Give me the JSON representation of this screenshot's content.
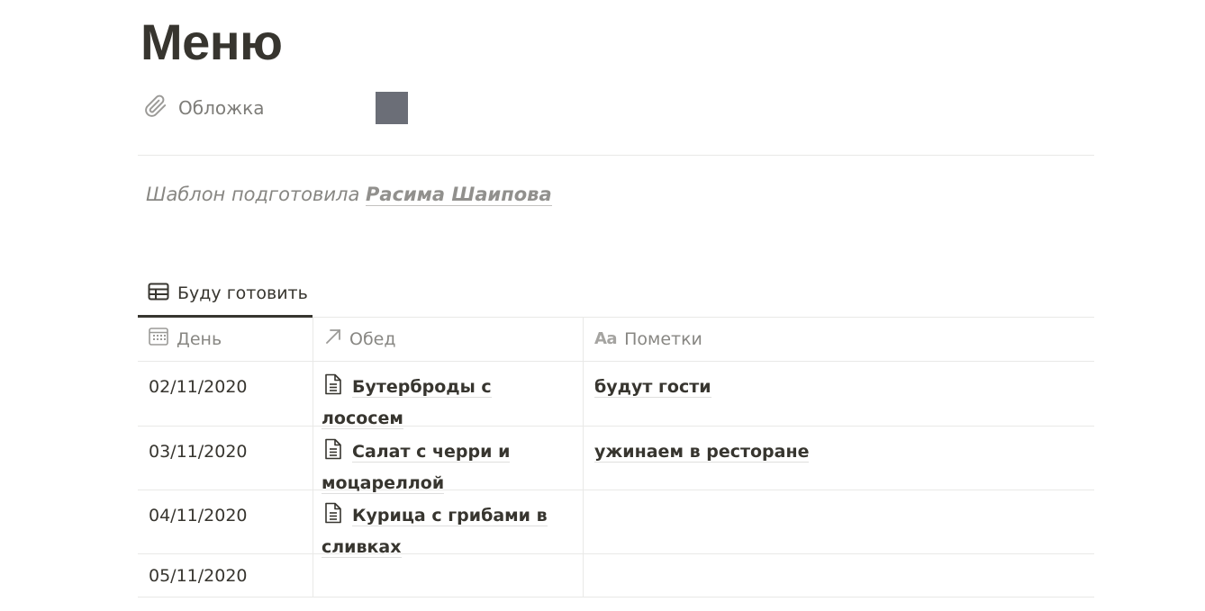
{
  "page": {
    "title": "Меню"
  },
  "properties": {
    "cover_label": "Обложка",
    "cover_color": "#6b6e77"
  },
  "credit": {
    "prefix": "Шаблон подготовила",
    "author": "Расима Шаипова"
  },
  "view": {
    "tab_label": "Буду готовить"
  },
  "table": {
    "columns": [
      {
        "label": "День",
        "icon": "calendar-icon"
      },
      {
        "label": "Обед",
        "icon": "relation-arrow-icon"
      },
      {
        "label": "Пометки",
        "icon": "text-aa-icon"
      }
    ],
    "rows": [
      {
        "date": "02/11/2020",
        "dish": "Бутерброды с лососем",
        "note": "будут гости"
      },
      {
        "date": "03/11/2020",
        "dish": "Салат с черри и моцареллой",
        "note": "ужинаем в ресторане"
      },
      {
        "date": "04/11/2020",
        "dish": "Курица с грибами в сливках",
        "note": ""
      },
      {
        "date": "05/11/2020",
        "dish": "",
        "note": ""
      }
    ]
  }
}
